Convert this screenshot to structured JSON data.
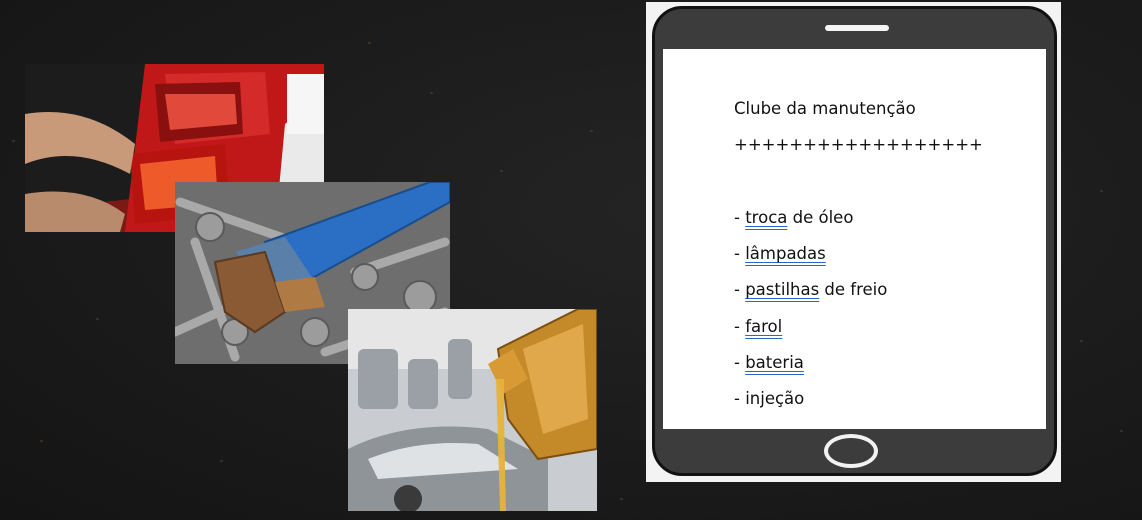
{
  "backgroundColor": "#1b1b1b",
  "photos": [
    {
      "subject": "car-taillight-icon"
    },
    {
      "subject": "wrench-tools-icon"
    },
    {
      "subject": "engine-oil-pour-icon"
    }
  ],
  "phone": {
    "title": "Clube da manutenção",
    "separator": "++++++++++++++++++",
    "items": [
      {
        "prefix": "- ",
        "underlined": "troca",
        "rest": " de óleo"
      },
      {
        "prefix": "- ",
        "underlined": "lâmpadas",
        "rest": ""
      },
      {
        "prefix": "- ",
        "underlined": "pastilhas",
        "rest": " de freio"
      },
      {
        "prefix": "- ",
        "underlined": "farol",
        "rest": ""
      },
      {
        "prefix": "- ",
        "underlined": "bateria",
        "rest": ""
      },
      {
        "prefix": "- ",
        "underlined": "",
        "rest": "injeção"
      }
    ]
  }
}
